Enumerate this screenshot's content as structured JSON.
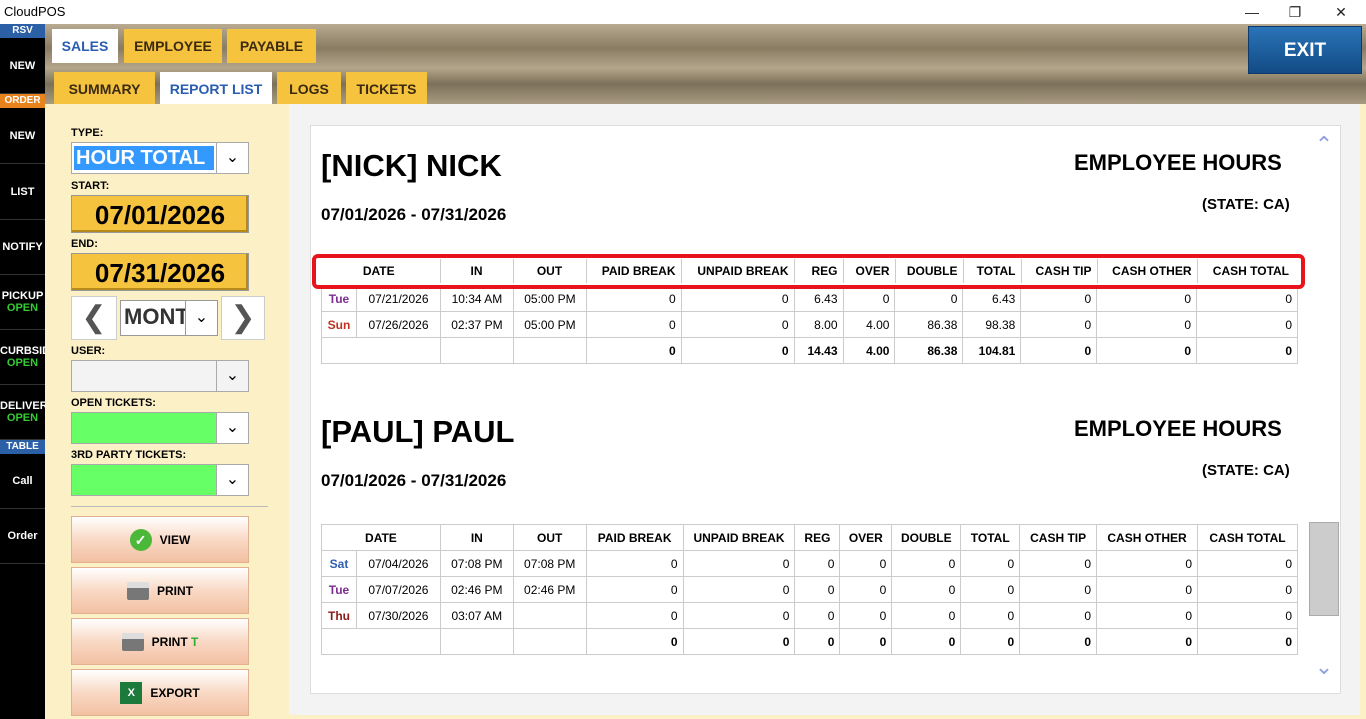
{
  "window": {
    "title": "CloudPOS",
    "minimize": "—",
    "restore": "❐",
    "close": "✕"
  },
  "sidebar": {
    "rsv_label": "RSV",
    "order_label": "ORDER",
    "table_label": "TABLE",
    "items": [
      {
        "label": "NEW",
        "sub": ""
      },
      {
        "label": "NEW",
        "sub": ""
      },
      {
        "label": "LIST",
        "sub": ""
      },
      {
        "label": "NOTIFY",
        "sub": ""
      },
      {
        "label": "PICKUP",
        "sub": "OPEN"
      },
      {
        "label": "CURBSIDE",
        "sub": "OPEN"
      },
      {
        "label": "DELIVERY",
        "sub": "OPEN"
      },
      {
        "label": "Call",
        "sub": ""
      },
      {
        "label": "Order",
        "sub": ""
      }
    ]
  },
  "tabs": {
    "main": [
      "SALES",
      "EMPLOYEE",
      "PAYABLE"
    ],
    "sub": [
      "SUMMARY",
      "REPORT LIST",
      "LOGS",
      "TICKETS"
    ],
    "exit": "EXIT"
  },
  "filters": {
    "type_label": "TYPE:",
    "type_value": "HOUR TOTAL",
    "start_label": "START:",
    "start_value": "07/01/2026",
    "end_label": "END:",
    "end_value": "07/31/2026",
    "period_value": "MONTH",
    "user_label": "USER:",
    "open_tickets_label": "OPEN TICKETS:",
    "third_party_label": "3RD PARTY TICKETS:"
  },
  "actions": {
    "view": "VIEW",
    "print": "PRINT",
    "print_t": "PRINT",
    "print_t_suffix": "T",
    "export": "EXPORT"
  },
  "icons": {
    "dropdown": "chevron-down-icon",
    "prev": "chevron-left-icon",
    "next": "chevron-right-icon",
    "view": "check-circle-icon",
    "print": "printer-icon",
    "export": "excel-icon",
    "scroll_up": "chevron-up-icon",
    "scroll_down": "chevron-down-icon"
  },
  "colors": {
    "accent_tab": "#f6c33f",
    "active_tab_text": "#2a5db0",
    "exit": "#1b5e9e",
    "highlight": "#e8141c",
    "open_status": "#33cc33"
  },
  "report": {
    "columns": [
      "DATE",
      "IN",
      "OUT",
      "PAID BREAK",
      "UNPAID BREAK",
      "REG",
      "OVER",
      "DOUBLE",
      "TOTAL",
      "CASH TIP",
      "CASH OTHER",
      "CASH TOTAL"
    ],
    "employees": [
      {
        "name": "[NICK] NICK",
        "range": "07/01/2026 - 07/31/2026",
        "title": "EMPLOYEE HOURS",
        "state": "(STATE: CA)",
        "rows": [
          [
            "Tue",
            "07/21/2026",
            "10:34 AM",
            "05:00 PM",
            "0",
            "0",
            "6.43",
            "0",
            "0",
            "6.43",
            "0",
            "0",
            "0"
          ],
          [
            "Sun",
            "07/26/2026",
            "02:37 PM",
            "05:00 PM",
            "0",
            "0",
            "8.00",
            "4.00",
            "86.38",
            "98.38",
            "0",
            "0",
            "0"
          ]
        ],
        "totals": [
          "",
          "",
          "",
          "",
          "0",
          "0",
          "14.43",
          "4.00",
          "86.38",
          "104.81",
          "0",
          "0",
          "0"
        ]
      },
      {
        "name": "[PAUL] PAUL",
        "range": "07/01/2026 - 07/31/2026",
        "title": "EMPLOYEE HOURS",
        "state": "(STATE: CA)",
        "rows": [
          [
            "Sat",
            "07/04/2026",
            "07:08 PM",
            "07:08 PM",
            "0",
            "0",
            "0",
            "0",
            "0",
            "0",
            "0",
            "0",
            "0"
          ],
          [
            "Tue",
            "07/07/2026",
            "02:46 PM",
            "02:46 PM",
            "0",
            "0",
            "0",
            "0",
            "0",
            "0",
            "0",
            "0",
            "0"
          ],
          [
            "Thu",
            "07/30/2026",
            "03:07 AM",
            "",
            "0",
            "0",
            "0",
            "0",
            "0",
            "0",
            "0",
            "0",
            "0"
          ]
        ],
        "totals": [
          "",
          "",
          "",
          "",
          "0",
          "0",
          "0",
          "0",
          "0",
          "0",
          "0",
          "0",
          "0"
        ]
      }
    ]
  }
}
